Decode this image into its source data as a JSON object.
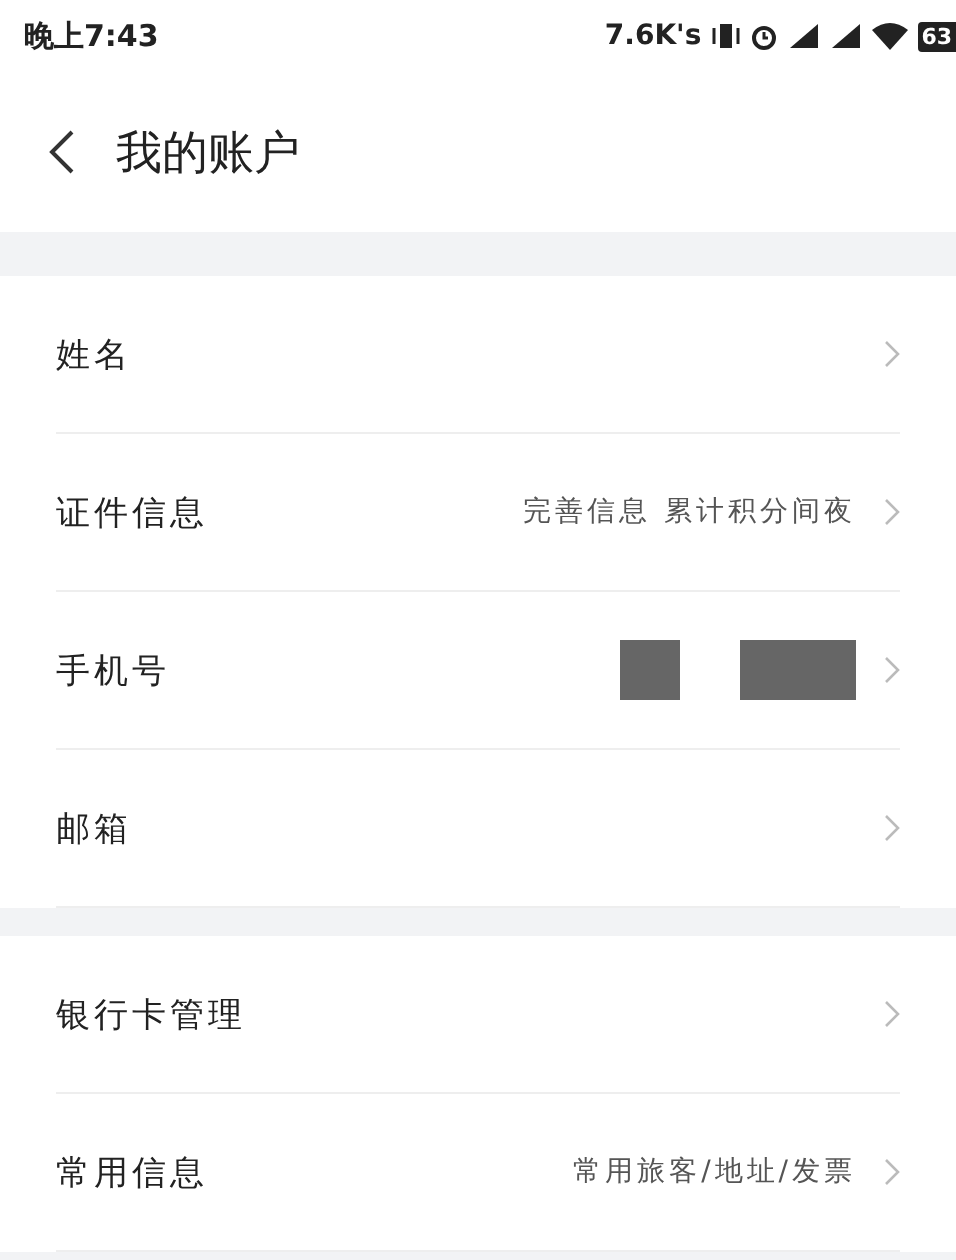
{
  "status_bar": {
    "time": "晚上7:43",
    "speed": "7.6K's",
    "battery": "63"
  },
  "header": {
    "title": "我的账户"
  },
  "groups": [
    {
      "rows": [
        {
          "kind": "plain",
          "label": "姓名"
        },
        {
          "kind": "hint",
          "label": "证件信息",
          "hint": "完善信息 累计积分间夜"
        },
        {
          "kind": "masked",
          "label": "手机号"
        },
        {
          "kind": "plain",
          "label": "邮箱"
        }
      ]
    },
    {
      "rows": [
        {
          "kind": "plain",
          "label": "银行卡管理"
        },
        {
          "kind": "hint",
          "label": "常用信息",
          "hint": "常用旅客/地址/发票"
        }
      ]
    }
  ]
}
